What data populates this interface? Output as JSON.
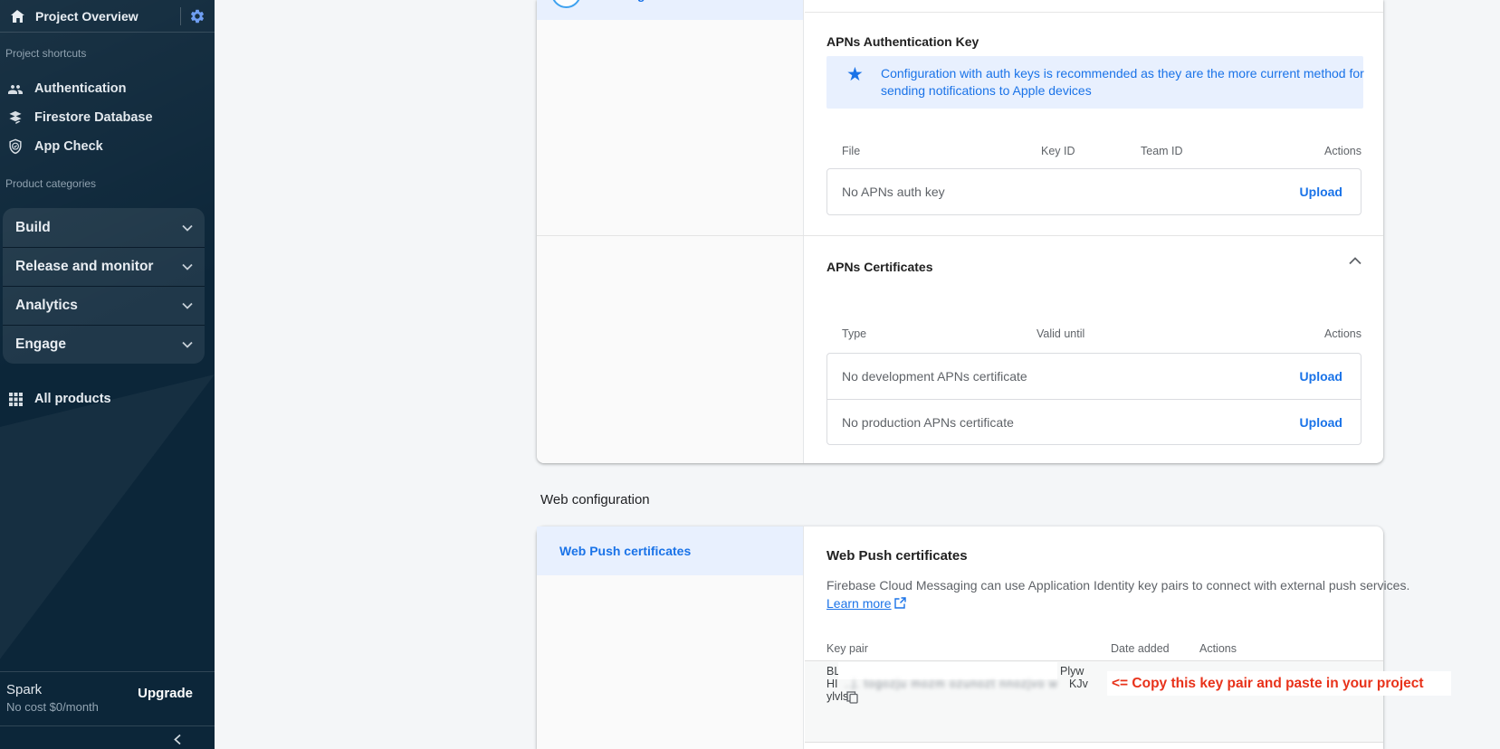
{
  "sidebar": {
    "title": "Project Overview",
    "shortcuts_label": "Project shortcuts",
    "shortcuts": [
      {
        "label": "Authentication"
      },
      {
        "label": "Firestore Database"
      },
      {
        "label": "App Check"
      }
    ],
    "categories_label": "Product categories",
    "categories": [
      {
        "label": "Build"
      },
      {
        "label": "Release and monitor"
      },
      {
        "label": "Analytics"
      },
      {
        "label": "Engage"
      }
    ],
    "all_products_label": "All products",
    "plan": {
      "name": "Spark",
      "cost": "No cost $0/month",
      "upgrade_label": "Upgrade"
    }
  },
  "apple_card": {
    "selected_app_fragment": "g",
    "auth_key": {
      "title": "APNs Authentication Key",
      "banner_text": "Configuration with auth keys is recommended as they are the more current method for sending notifications to Apple devices",
      "columns": {
        "file": "File",
        "key_id": "Key ID",
        "team_id": "Team ID",
        "actions": "Actions"
      },
      "empty_text": "No APNs auth key",
      "upload_label": "Upload"
    },
    "certificates": {
      "title": "APNs Certificates",
      "columns": {
        "type": "Type",
        "valid_until": "Valid until",
        "actions": "Actions"
      },
      "rows": [
        {
          "label": "No development APNs certificate",
          "action": "Upload"
        },
        {
          "label": "No production APNs certificate",
          "action": "Upload"
        }
      ]
    }
  },
  "web_section": {
    "label": "Web configuration",
    "tab_label": "Web Push certificates",
    "heading": "Web Push certificates",
    "description": "Firebase Cloud Messaging can use Application Identity key pairs to connect with external push services.",
    "learn_more_label": "Learn more",
    "columns": {
      "key_pair": "Key pair",
      "date_added": "Date added",
      "actions": "Actions"
    },
    "key_pair": {
      "line1_start": "BL",
      "line1_end": "Plyw",
      "line2_start": "HI",
      "line2_blurred": "..j. togozju mozm ozunozt nnozjvo wnoz",
      "line2_end": "KJv",
      "line3": "ylvls"
    },
    "annotation": "<= Copy this key pair and paste in your project"
  },
  "colors": {
    "accent": "#1a73e8",
    "banner_bg": "#e8f0fe",
    "annotation_red": "#e8321a",
    "sidebar_bg": "#0c2639"
  }
}
